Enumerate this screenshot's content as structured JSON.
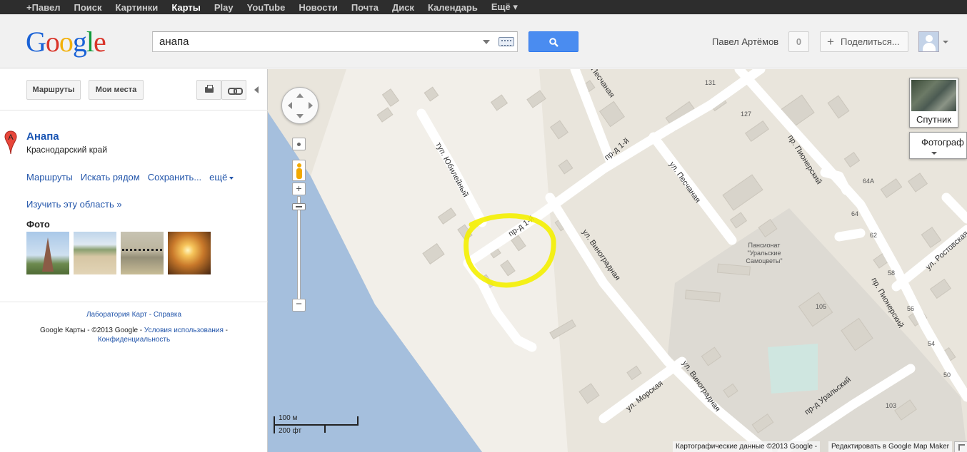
{
  "gbar": {
    "items": [
      "+Павел",
      "Поиск",
      "Картинки",
      "Карты",
      "Play",
      "YouTube",
      "Новости",
      "Почта",
      "Диск",
      "Календарь",
      "Ещё ▾"
    ]
  },
  "header": {
    "logo": [
      "G",
      "o",
      "o",
      "g",
      "l",
      "e"
    ],
    "search_value": "анапа",
    "user_name": "Павел Артёмов",
    "notifications": "0",
    "share_label": "Поделиться..."
  },
  "panel": {
    "routes_button": "Маршруты",
    "places_button": "Мои места",
    "place_title": "Анапа",
    "place_subtitle": "Краснодарский край",
    "actions": [
      "Маршруты",
      "Искать рядом",
      "Сохранить...",
      "ещё"
    ],
    "explore_link": "Изучить эту область »",
    "photos_label": "Фото",
    "footer_links": [
      "Лаборатория Карт",
      "Справка"
    ],
    "footer_text": "Google Карты - ©2013 Google - ",
    "footer_terms": "Условия использования",
    "footer_privacy": "Конфиденциальность"
  },
  "map": {
    "satellite_label": "Спутник",
    "photo_label": "Фотограф",
    "scale_metric": "100 м",
    "scale_imperial": "200 фт",
    "attribution": "Картографические данные ©2013 Google -",
    "edit_link": "Редактировать в Google Map Maker",
    "streets": {
      "yubileyny": "туп. Юбилейный",
      "first_a": "пр-д 1-й",
      "first_b": "пр-д 1-й",
      "vinogradnaya_a": "ул. Виноградная",
      "vinogradnaya_b": "ул. Виноградная",
      "peschanaya_a": "ул. Песчаная",
      "peschanaya_b": "Песчаная",
      "morskaya": "ул. Морская",
      "pionersky_a": "пр. Пионерский",
      "pionersky_b": "пр. Пионерский",
      "uralsky": "пр-д Уральский",
      "rostovskaya": "ул. Ростовская"
    },
    "poi_label": [
      "Пансионат",
      "\"Уральские",
      "Самоцветы\""
    ],
    "house_numbers": [
      "131",
      "127",
      "64А",
      "64",
      "62",
      "58",
      "56",
      "54",
      "50",
      "105",
      "103"
    ]
  }
}
